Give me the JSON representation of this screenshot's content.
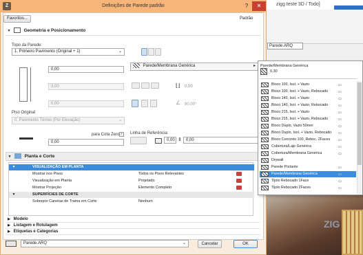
{
  "dialog": {
    "title": "Definições de Parede padrão",
    "icon_letter": "Z",
    "help": "?",
    "close": "✕",
    "favorites_button": "Favoritos...",
    "default_label": "Padrão"
  },
  "geometry": {
    "section_title": "Geometria e Posicionamento",
    "top_label": "Topo da Parede:",
    "top_value": "1. Primeiro Pavimento (Original + 1)",
    "height_value": "0,00",
    "thickness_value": "3,00",
    "offset_value": "0,00",
    "base_label": "Piso Original",
    "base_value": "0. Pavimento Térreo (Por Elevação)",
    "base_offset_label": "para Cota Zero",
    "base_offset_value": "0,00",
    "composite_value": "Parede/Membrana Genérica",
    "ref_line_label": "Linha de Referência:",
    "angle_value": "0,00",
    "inclination_value": "90,00°",
    "ref_offset_value": "0,00",
    "right_thickness_value": "0,00"
  },
  "planta": {
    "section_title": "Planta e Corte",
    "rows": [
      {
        "kind": "header-selected",
        "label": "VISUALIZAÇÃO EM PLANTA",
        "value": ""
      },
      {
        "kind": "row",
        "label": "Mostrar nos Pisos",
        "value": "Todos os Pisos Relevantes"
      },
      {
        "kind": "row",
        "label": "Visualização em Planta",
        "value": "Projetado"
      },
      {
        "kind": "row",
        "label": "Mostrar Projeção",
        "value": "Elemento Completo"
      },
      {
        "kind": "header",
        "label": "SUPERFÍCIES DE CORTE",
        "value": ""
      },
      {
        "kind": "row",
        "label": "Sobrepor Canetas de Trama em Corte",
        "value": "Nenhum"
      }
    ]
  },
  "collapsed_sections": [
    "Modelo",
    "Listagem e Rotulagem",
    "Etiquetas e Categorias"
  ],
  "footer": {
    "layer_value": "Parede.ARQ",
    "cancel": "Cancelar",
    "ok": "OK"
  },
  "popup": {
    "header": "Parede/Membrana Genérica",
    "thickness": "0,30",
    "items": [
      {
        "label": "Bloco 100, Isol. + Vazio",
        "tag": "▭",
        "selected": false
      },
      {
        "label": "Bloco 100, Isol. + Vazio, Rebocado",
        "tag": "▭",
        "selected": false
      },
      {
        "label": "Bloco 140, Isol. + Vazio",
        "tag": "▭",
        "selected": false
      },
      {
        "label": "Bloco 140, Isol. + Vazio, Rebocado",
        "tag": "▭",
        "selected": false
      },
      {
        "label": "Bloco 215, Isol. + Vazio",
        "tag": "▭",
        "selected": false
      },
      {
        "label": "Bloco 215, Isol. + Vazio, Rebocado",
        "tag": "▭",
        "selected": false
      },
      {
        "label": "Bloco Duplo, Vazio 50mm",
        "tag": "▭",
        "selected": false
      },
      {
        "label": "Bloco Duplo, Isol. + Vazio, Rebocado",
        "tag": "▭",
        "selected": false
      },
      {
        "label": "Bloco Concreto 100, Reboc. 2Faces",
        "tag": "▭",
        "selected": false
      },
      {
        "label": "Cobertura/Laje Genérica",
        "tag": "▭",
        "selected": false
      },
      {
        "label": "Cobertura/Membrana Genérica",
        "tag": "▭",
        "selected": false
      },
      {
        "label": "Drywall",
        "tag": "",
        "selected": false
      },
      {
        "label": "Parede Portante",
        "tag": "▭",
        "selected": false
      },
      {
        "label": "Parede/Membrana Genérica",
        "tag": "▭",
        "selected": true
      },
      {
        "label": "Tijolo Rebocado 1Face",
        "tag": "▭",
        "selected": false
      },
      {
        "label": "Tijolo Rebocado 2Faces",
        "tag": "▭",
        "selected": false
      }
    ]
  },
  "background": {
    "window_title": "zigg teste 3D / Todo]",
    "layer_combo": "Parede.ARQ",
    "watermark": "ZIG"
  },
  "colors": {
    "dialog_title_bar": "#f7b57a",
    "dialog_frame": "#f9ecdc",
    "selection_blue": "#3b8ddc",
    "close_red": "#c84030"
  }
}
